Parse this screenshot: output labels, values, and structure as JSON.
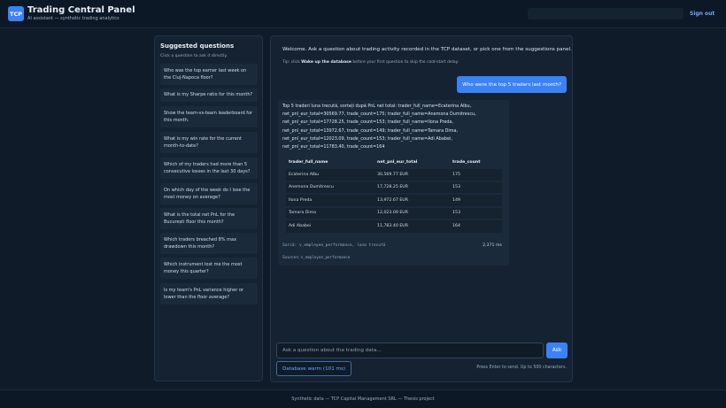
{
  "header": {
    "logo_text": "TCP",
    "title": "Trading Central Panel",
    "subtitle": "AI assistant — synthetic trading analytics",
    "signout_label": "Sign out"
  },
  "sidebar": {
    "title": "Suggested questions",
    "hint": "Click a question to ask it directly.",
    "questions": [
      "Who was the top earner last week on the Cluj-Napoca floor?",
      "What is my Sharpe ratio for this month?",
      "Show the team-vs-team leaderboard for this month.",
      "What is my win rate for the current month-to-date?",
      "Which of my traders had more than 5 consecutive losses in the last 30 days?",
      "On which day of the week do I lose the most money on average?",
      "What is the total net PnL for the București floor this month?",
      "Which traders breached 8% max drawdown this month?",
      "Which instrument lost me the most money this quarter?",
      "Is my team's PnL variance higher or lower than the floor average?"
    ]
  },
  "chat": {
    "welcome": "Welcome. Ask a question about trading activity recorded in the TCP dataset, or pick one from the suggestions panel.",
    "tip_prefix": "Tip: click",
    "tip_strong": "Wake up the database",
    "tip_suffix": "before your first question to skip the cold-start delay.",
    "user_message": "Who were the top 5 traders last month?",
    "answer_text": "Top 5 traderi luna trecută, sortați după PnL net total: trader_full_name=Ecaterina Albu, net_pnl_eur_total=30569.77, trade_count=175; trader_full_name=Anemona Dumitrescu, net_pnl_eur_total=17728.25, trade_count=153; trader_full_name=Ilona Preda, net_pnl_eur_total=13972.67, trade_count=149; trader_full_name=Tamara Dima, net_pnl_eur_total=12023.09, trade_count=153; trader_full_name=Adi Ababei, net_pnl_eur_total=11783.40, trade_count=164",
    "table": {
      "headers": [
        "trader_full_name",
        "net_pnl_eur_total",
        "trade_count"
      ],
      "rows": [
        [
          "Ecaterina Albu",
          "30,569.77 EUR",
          "175"
        ],
        [
          "Anemona Dumitrescu",
          "17,728.25 EUR",
          "153"
        ],
        [
          "Ilona Preda",
          "13,972.67 EUR",
          "149"
        ],
        [
          "Tamara Dima",
          "12,023.09 EUR",
          "153"
        ],
        [
          "Adi Ababei",
          "11,783.40 EUR",
          "164"
        ]
      ]
    },
    "source_line": "Sursă: v_employee_performance, luna trecută",
    "elapsed": "2,371 ms",
    "sources_label": "Sources:",
    "sources_value": "v_employee_performance"
  },
  "composer": {
    "placeholder": "Ask a question about the trading data...",
    "ask_label": "Ask",
    "db_label": "Database warm (101 ms)",
    "hint": "Press Enter to send. Up to 500 characters."
  },
  "footer": {
    "text": "Synthetic data — TCP Capital Management SRL — Thesis project"
  },
  "colors": {
    "accent": "#3b82f6",
    "background": "#0f1b29",
    "panel": "#152231"
  }
}
